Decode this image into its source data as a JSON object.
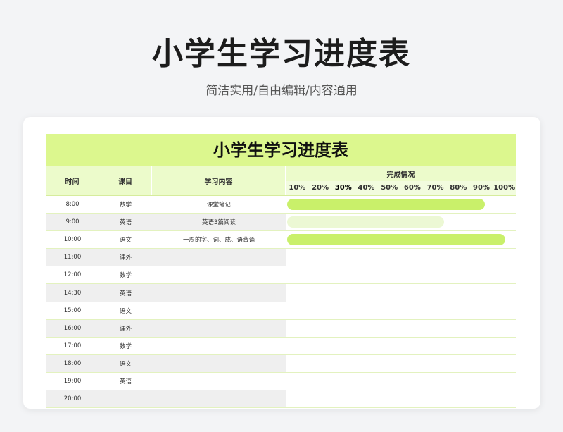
{
  "header": {
    "title": "小学生学习进度表",
    "subtitle": "简洁实用/自由编辑/内容通用"
  },
  "sheet": {
    "title": "小学生学习进度表",
    "columns": {
      "time": "时间",
      "subject": "课目",
      "content": "学习内容",
      "progress": "完成情况"
    },
    "ticks": [
      "10%",
      "20%",
      "30%",
      "40%",
      "50%",
      "60%",
      "70%",
      "80%",
      "90%",
      "100%"
    ],
    "rows": [
      {
        "time": "8:00",
        "subject": "数学",
        "content": "课堂笔记",
        "progress": 0.87,
        "bar_color": "#c9f06a"
      },
      {
        "time": "9:00",
        "subject": "英语",
        "content": "英语3篇阅读",
        "progress": 0.69,
        "bar_color": "#ecf8d4"
      },
      {
        "time": "10:00",
        "subject": "语文",
        "content": "一周的字、词、成、语背诵",
        "progress": 0.96,
        "bar_color": "#c9f06a"
      },
      {
        "time": "11:00",
        "subject": "课外",
        "content": "",
        "progress": null,
        "bar_color": ""
      },
      {
        "time": "12:00",
        "subject": "数学",
        "content": "",
        "progress": null,
        "bar_color": ""
      },
      {
        "time": "14:30",
        "subject": "英语",
        "content": "",
        "progress": null,
        "bar_color": ""
      },
      {
        "time": "15:00",
        "subject": "语文",
        "content": "",
        "progress": null,
        "bar_color": ""
      },
      {
        "time": "16:00",
        "subject": "课外",
        "content": "",
        "progress": null,
        "bar_color": ""
      },
      {
        "time": "17:00",
        "subject": "数学",
        "content": "",
        "progress": null,
        "bar_color": ""
      },
      {
        "time": "18:00",
        "subject": "语文",
        "content": "",
        "progress": null,
        "bar_color": ""
      },
      {
        "time": "19:00",
        "subject": "英语",
        "content": "",
        "progress": null,
        "bar_color": ""
      },
      {
        "time": "20:00",
        "subject": "",
        "content": "",
        "progress": null,
        "bar_color": ""
      }
    ]
  }
}
